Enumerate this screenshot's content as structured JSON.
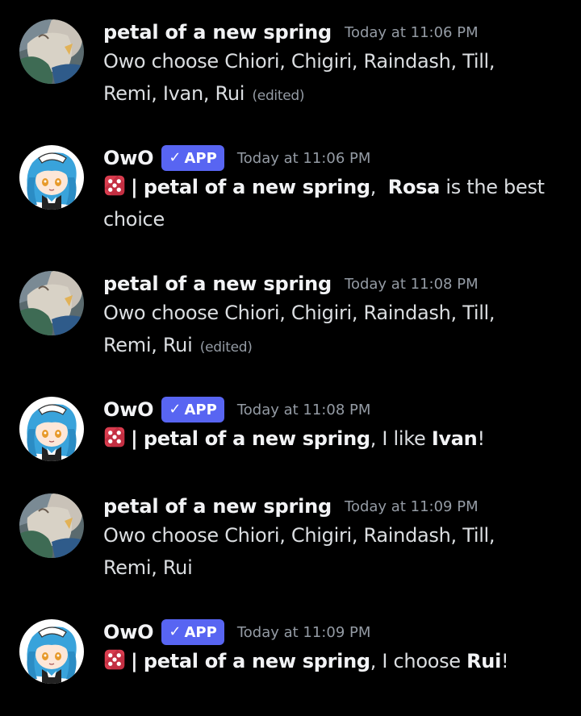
{
  "colors": {
    "background": "#000000",
    "author": "#f2f3f5",
    "text": "#dbdee1",
    "muted": "#949ba4",
    "app_badge": "#5865f2",
    "dice": "#d83c4e"
  },
  "messages": [
    {
      "author": "petal of a new spring",
      "timestamp": "Today at 11:06 PM",
      "line1": "Owo choose Chiori, Chigiri, Raindash, Till,",
      "line2": "Remi, Ivan, Rui",
      "edited": "(edited)"
    },
    {
      "author": "OwO",
      "badge": "APP",
      "badge_icon": "checkmark-icon",
      "timestamp": "Today at 11:06 PM",
      "dice_icon": "game-die-icon",
      "sep": "|",
      "mention": "petal of a new spring",
      "comma": ",",
      "pick": "Rosa",
      "after": " is the best",
      "line2": "choice"
    },
    {
      "author": "petal of a new spring",
      "timestamp": "Today at 11:08 PM",
      "line1": "Owo choose Chiori, Chigiri, Raindash, Till,",
      "line2": "Remi, Rui",
      "edited": "(edited)"
    },
    {
      "author": "OwO",
      "badge": "APP",
      "badge_icon": "checkmark-icon",
      "timestamp": "Today at 11:08 PM",
      "dice_icon": "game-die-icon",
      "sep": "|",
      "mention": "petal of a new spring",
      "comma": ",",
      "before": " I like ",
      "pick": "Ivan",
      "after": "!"
    },
    {
      "author": "petal of a new spring",
      "timestamp": "Today at 11:09 PM",
      "line1": "Owo choose Chiori, Chigiri, Raindash, Till,",
      "line2": "Remi, Rui"
    },
    {
      "author": "OwO",
      "badge": "APP",
      "badge_icon": "checkmark-icon",
      "timestamp": "Today at 11:09 PM",
      "dice_icon": "game-die-icon",
      "sep": "|",
      "mention": "petal of a new spring",
      "comma": ",",
      "before": " I choose ",
      "pick": "Rui",
      "after": "!"
    }
  ]
}
